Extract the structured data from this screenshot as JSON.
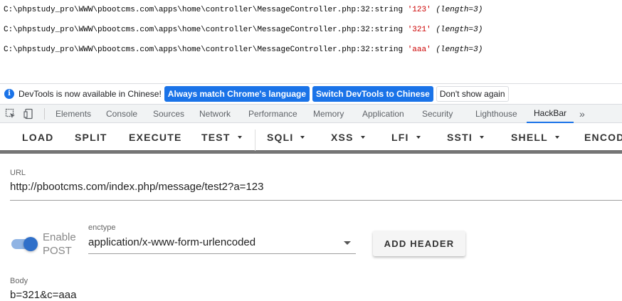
{
  "dump_lines": [
    {
      "prefix": "C:\\phpstudy_pro\\WWW\\pbootcms.com\\apps\\home\\controller\\MessageController.php:32:string ",
      "value": "'123'",
      "length": "(length=3)"
    },
    {
      "prefix": "C:\\phpstudy_pro\\WWW\\pbootcms.com\\apps\\home\\controller\\MessageController.php:32:string ",
      "value": "'321'",
      "length": "(length=3)"
    },
    {
      "prefix": "C:\\phpstudy_pro\\WWW\\pbootcms.com\\apps\\home\\controller\\MessageController.php:32:string ",
      "value": "'aaa'",
      "length": "(length=3)"
    }
  ],
  "infobar": {
    "icon": "info-icon",
    "text": "DevTools is now available in Chinese!",
    "btn_match": "Always match Chrome's language",
    "btn_switch": "Switch DevTools to Chinese",
    "btn_dismiss": "Don't show again"
  },
  "tabs": [
    "Elements",
    "Console",
    "Sources",
    "Network",
    "Performance",
    "Memory",
    "Application",
    "Security",
    "Lighthouse",
    "HackBar"
  ],
  "tabs_more": "»",
  "active_tab": "HackBar",
  "hackbar": {
    "buttons": [
      "LOAD",
      "SPLIT",
      "EXECUTE",
      "TEST",
      "SQLI",
      "XSS",
      "LFI",
      "SSTI",
      "SHELL",
      "ENCODING"
    ],
    "url_label": "URL",
    "url_value": "http://pbootcms.com/index.php/message/test2?a=123",
    "enable_post": "Enable POST",
    "enctype_label": "enctype",
    "enctype_value": "application/x-www-form-urlencoded",
    "add_header": "ADD HEADER",
    "body_label": "Body",
    "body_value": "b=321&c=aaa"
  },
  "colors": {
    "accent": "#1a73e8",
    "string_red": "#cc0000"
  }
}
